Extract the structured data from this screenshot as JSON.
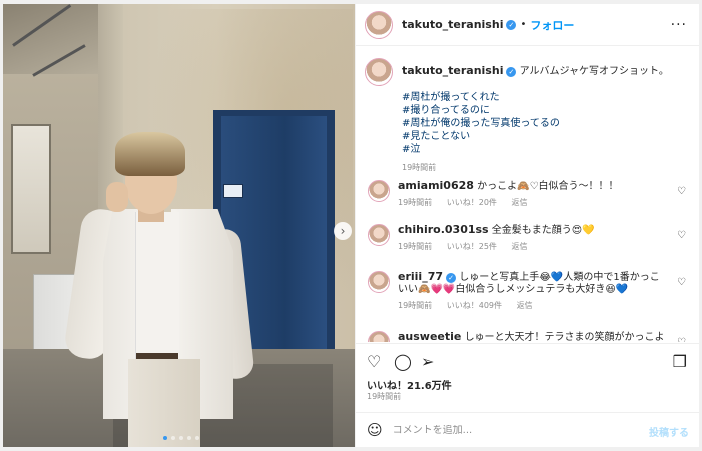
{
  "header": {
    "username": "takuto_teranishi",
    "separator": "•",
    "follow_label": "フォロー",
    "more_label": "···"
  },
  "caption": {
    "username": "takuto_teranishi",
    "text": "アルバムジャケ写オフショット。",
    "hashtags": [
      "#周杜が撮ってくれた",
      "#撮り合ってるのに",
      "#周杜が俺の撮った写真使ってるの",
      "#見たことない",
      "#泣"
    ],
    "time": "19時間前"
  },
  "comments": [
    {
      "username": "amiami0628",
      "verified": false,
      "text": "かっこよ🙈♡白似合う〜！！！",
      "time": "19時間前",
      "likes": "いいね！20件",
      "reply": "返信"
    },
    {
      "username": "chihiro.0301ss",
      "verified": false,
      "text": "全金髪もまた顔う😍💛",
      "time": "19時間前",
      "likes": "いいね！25件",
      "reply": "返信"
    },
    {
      "username": "eriii_77",
      "verified": true,
      "text": "しゅーと写真上手😂💙人類の中で1番かっこいい🙈💗💗白似合うしメッシュテラも大好き😆💙",
      "time": "19時間前",
      "likes": "いいね！409件",
      "reply": "返信"
    },
    {
      "username": "ausweetie",
      "verified": false,
      "text": "しゅーと大天才！テラさまの笑顔がかっこよすぎ",
      "time": "",
      "likes": "",
      "reply": ""
    }
  ],
  "actions": {
    "like_icon": "heart-icon",
    "comment_icon": "comment-icon",
    "share_icon": "share-icon",
    "save_icon": "bookmark-icon"
  },
  "likes_text": "いいね！21.6万件",
  "post_time": "19時間前",
  "composer": {
    "placeholder": "コメントを追加...",
    "post_label": "投稿する"
  },
  "carousel": {
    "next_label": "›",
    "total_slides": 5,
    "active_slide": 1
  },
  "colors": {
    "accent": "#0095f6",
    "verified": "#3797ef",
    "hashtag": "#00376b",
    "muted": "#8e8e8e"
  }
}
